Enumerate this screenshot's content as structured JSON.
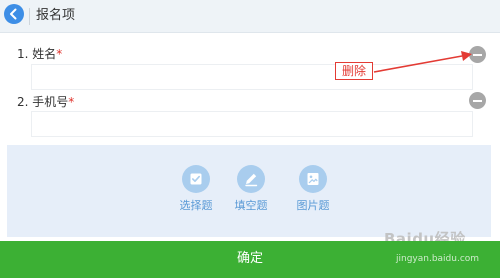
{
  "header": {
    "title": "报名项"
  },
  "fields": [
    {
      "label": "1. 姓名",
      "required_mark": "*"
    },
    {
      "label": "2. 手机号",
      "required_mark": "*"
    }
  ],
  "annotation": {
    "text": "删除",
    "color": "#e33b34"
  },
  "tools": [
    {
      "label": "选择题",
      "icon": "checkbox-icon"
    },
    {
      "label": "填空题",
      "icon": "pencil-icon"
    },
    {
      "label": "图片题",
      "icon": "image-icon"
    }
  ],
  "confirm": {
    "label": "确定"
  },
  "watermark": {
    "logo": "Baidu经验",
    "url": "jingyan.baidu.com"
  },
  "colors": {
    "accent": "#3d8ee6",
    "confirm_bg": "#3cb034",
    "panel_bg": "#e6eef9",
    "tool_label": "#5a9ad6"
  }
}
